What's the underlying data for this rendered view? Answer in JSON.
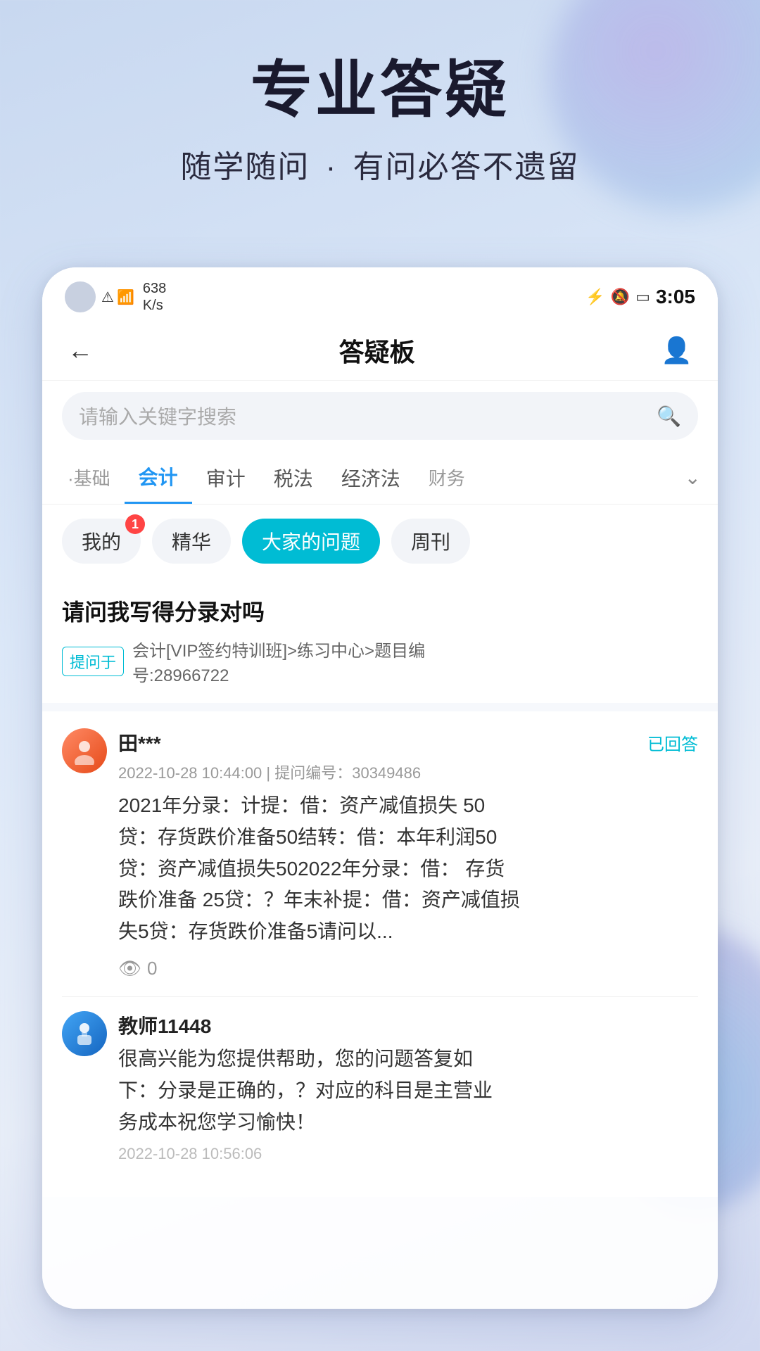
{
  "hero": {
    "title": "专业答疑",
    "subtitle_part1": "随学随问",
    "dot": "·",
    "subtitle_part2": "有问必答不遗留"
  },
  "status_bar": {
    "speed": "638\nK/s",
    "time": "3:05"
  },
  "nav": {
    "title": "答疑板",
    "back_icon": "←",
    "user_icon": "👤"
  },
  "search": {
    "placeholder": "请输入关键字搜索"
  },
  "categories": [
    {
      "label": "·基础",
      "active": false,
      "partial": true
    },
    {
      "label": "会计",
      "active": true
    },
    {
      "label": "审计",
      "active": false
    },
    {
      "label": "税法",
      "active": false
    },
    {
      "label": "经济法",
      "active": false
    },
    {
      "label": "财务",
      "active": false,
      "partial": true
    }
  ],
  "filter_tabs": [
    {
      "label": "我的",
      "active": false,
      "badge": "1"
    },
    {
      "label": "精华",
      "active": false
    },
    {
      "label": "大家的问题",
      "active": true
    },
    {
      "label": "周刊",
      "active": false
    }
  ],
  "question": {
    "title": "请问我写得分录对吗",
    "tag": "提问于",
    "source": "会计[VIP签约特训班]>练习中心>题目编\n号:28966722"
  },
  "answer": {
    "student": {
      "name": "田***",
      "status": "已回答",
      "time_info": "2022-10-28 10:44:00 | 提问编号：30349486",
      "text": "2021年分录：计提：借：资产减值损失 50\n贷：存货跌价准备50结转：借：本年利润50\n贷：资产减值损失502022年分录：借： 存货\n跌价准备 25贷：？年末补提：借：资产减值损\n失5贷：存货跌价准备5请问以...",
      "views": "0"
    },
    "teacher": {
      "name": "教师11448",
      "text": "很高兴能为您提供帮助，您的问题答复如\n下：分录是正确的，？对应的科目是主营业\n务成本祝您学习愉快！",
      "time": "2022-10-28 10:56:06"
    }
  },
  "icons": {
    "search": "🔍",
    "back": "←",
    "user": "⚙",
    "eye": "👁",
    "chevron_down": "⌄",
    "wifi": "📶",
    "bluetooth": "⚡",
    "battery": "🔋",
    "bell_mute": "🔕"
  }
}
